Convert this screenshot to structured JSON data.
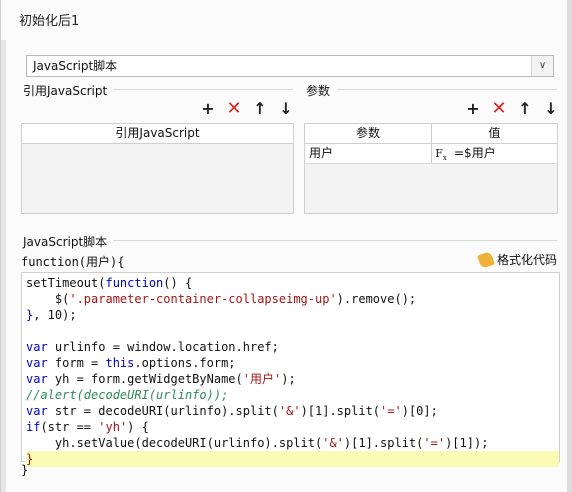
{
  "window": {
    "title": "初始化后1"
  },
  "script_type_select": {
    "value": "JavaScript脚本"
  },
  "referenced_js": {
    "section_label": "引用JavaScript",
    "header": "引用JavaScript",
    "rows": []
  },
  "params": {
    "section_label": "参数",
    "headers": [
      "参数",
      "值"
    ],
    "rows": [
      {
        "name": "用户",
        "value": "=$用户"
      }
    ]
  },
  "script": {
    "section_label": "JavaScript脚本",
    "function_header": "function(用户){",
    "function_footer": "}",
    "format_button": "格式化代码"
  },
  "colors": {
    "keyword": "#0000c8",
    "string": "#a31515",
    "comment": "#2e8b57",
    "delete_icon": "#d22222",
    "highlight_line": "#fbfbb5"
  },
  "toolbar_icons": [
    "plus-icon",
    "delete-icon",
    "arrow-up-icon",
    "arrow-down-icon"
  ]
}
